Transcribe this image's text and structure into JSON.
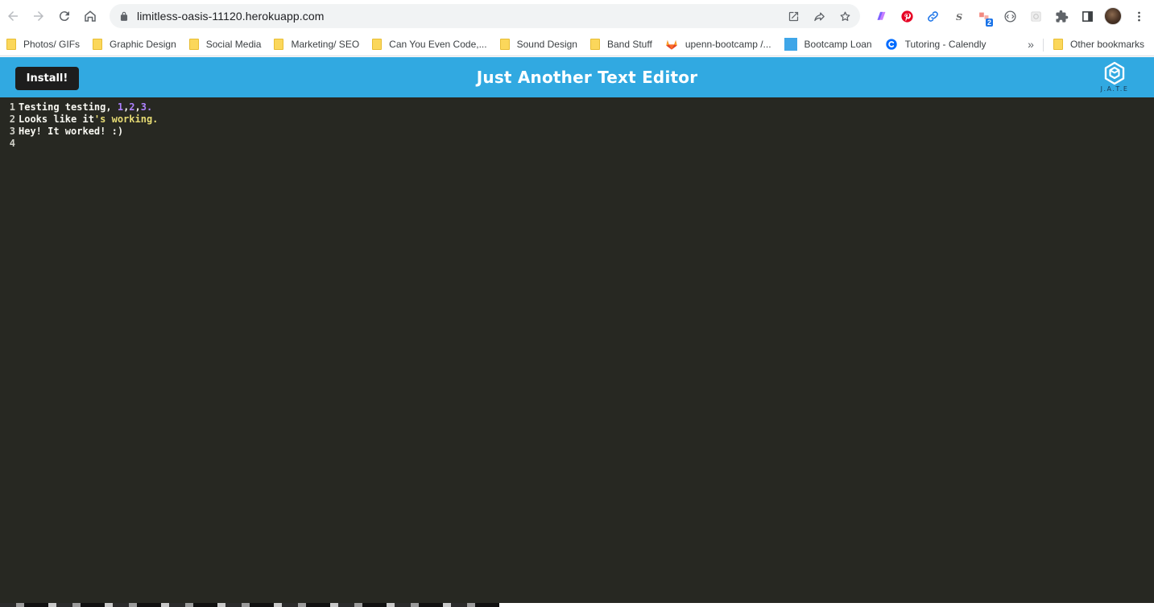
{
  "browser": {
    "url": "limitless-oasis-11120.herokuapp.com",
    "extensions": [
      {
        "name": "gradient-extension-icon"
      },
      {
        "name": "pinterest-icon"
      },
      {
        "name": "link-extension-icon"
      },
      {
        "name": "s-extension-icon"
      },
      {
        "name": "blocker-extension-icon",
        "badge": "2"
      },
      {
        "name": "devtools-extension-icon"
      },
      {
        "name": "frame-extension-icon"
      },
      {
        "name": "puzzle-icon"
      },
      {
        "name": "side-panel-icon"
      }
    ]
  },
  "bookmarks": {
    "items": [
      {
        "label": "Photos/ GIFs",
        "icon": "folder-icon"
      },
      {
        "label": "Graphic Design",
        "icon": "folder-icon"
      },
      {
        "label": "Social Media",
        "icon": "folder-icon"
      },
      {
        "label": "Marketing/ SEO",
        "icon": "folder-icon"
      },
      {
        "label": "Can You Even Code,...",
        "icon": "folder-icon"
      },
      {
        "label": "Sound Design",
        "icon": "folder-icon"
      },
      {
        "label": "Band Stuff",
        "icon": "folder-icon"
      },
      {
        "label": "upenn-bootcamp /...",
        "icon": "gitlab-icon"
      },
      {
        "label": "Bootcamp Loan",
        "icon": "blue-square-icon"
      },
      {
        "label": "Tutoring - Calendly",
        "icon": "calendly-icon"
      }
    ],
    "more": "»",
    "other": "Other bookmarks"
  },
  "app": {
    "install_label": "Install!",
    "title": "Just Another Text Editor",
    "logo_text": "J.A.T.E",
    "header_color": "#31a9e1",
    "editor_bg": "#272822"
  },
  "editor": {
    "lines": [
      {
        "number": "1",
        "segments": [
          {
            "text": "Testing testing, ",
            "type": "plain"
          },
          {
            "text": "1",
            "type": "num"
          },
          {
            "text": ",",
            "type": "plain"
          },
          {
            "text": "2",
            "type": "num"
          },
          {
            "text": ",",
            "type": "plain"
          },
          {
            "text": "3.",
            "type": "num"
          }
        ]
      },
      {
        "number": "2",
        "segments": [
          {
            "text": "Looks like it",
            "type": "plain"
          },
          {
            "text": "'s working.",
            "type": "str"
          }
        ]
      },
      {
        "number": "3",
        "segments": [
          {
            "text": "Hey! It worked! :)",
            "type": "plain"
          }
        ]
      },
      {
        "number": "4",
        "segments": []
      }
    ]
  }
}
